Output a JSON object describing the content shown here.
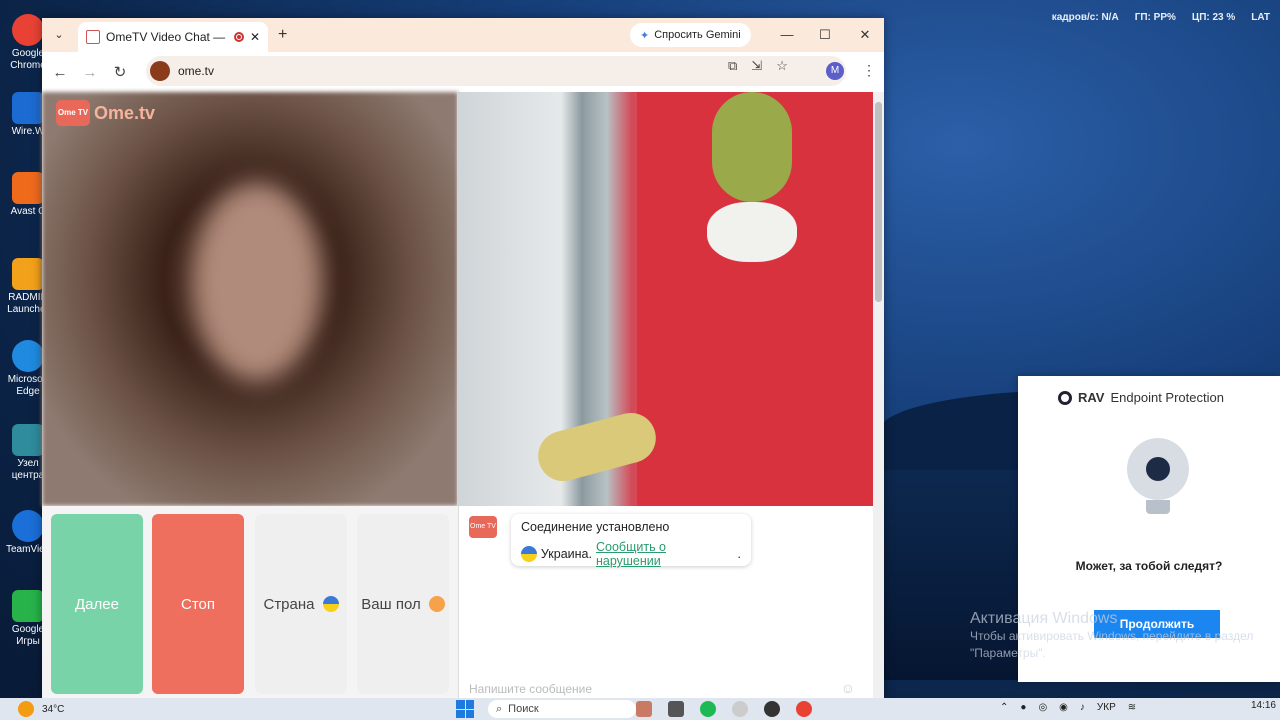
{
  "desktop": {
    "sysinfo": [
      "кадров/с: N/A",
      "ГП: PP%",
      "ЦП: 23 %",
      "LAT"
    ],
    "icons": [
      {
        "label": "Google Chrome",
        "color": "#e94235"
      },
      {
        "label": "Wire.W",
        "color": "#1b6bd2"
      },
      {
        "label": "Avast C",
        "color": "#f06a1c"
      },
      {
        "label": "RADMIR Launcher",
        "color": "#f2a11a"
      },
      {
        "label": "Microsoft Edge",
        "color": "#1f8adf"
      },
      {
        "label": "Узел центра",
        "color": "#2e8c9c"
      },
      {
        "label": "TeamView",
        "color": "#1a6fd8"
      },
      {
        "label": "Google Игры",
        "color": "#27b34a"
      }
    ],
    "activation": {
      "title": "Активация Windows",
      "text": "Чтобы активировать Windows, перейдите в раздел \"Параметры\"."
    }
  },
  "browser": {
    "tab": {
      "title": "OmeTV Video Chat — Ome"
    },
    "gemini_label": "Спросить Gemini",
    "url": "ome.tv",
    "profile_initial": "M"
  },
  "page": {
    "logo_box": "Ome TV",
    "logo_text": "Ome.tv",
    "buttons": {
      "next": "Далее",
      "stop": "Стоп",
      "country": "Страна",
      "gender": "Ваш пол"
    },
    "chat": {
      "logo": "Ome TV",
      "status": "Соединение установлено",
      "country": "Украина.",
      "report_link": "Сообщить о нарушении",
      "report_suffix": ".",
      "input_placeholder": "Напишите сообщение"
    }
  },
  "rav": {
    "brand": "RAV",
    "product": "Endpoint Protection",
    "question": "Может, за тобой следят?",
    "button": "Продолжить"
  },
  "taskbar": {
    "temperature": "34°C",
    "search_placeholder": "Поиск",
    "language": "УКР",
    "time": "14:16"
  }
}
